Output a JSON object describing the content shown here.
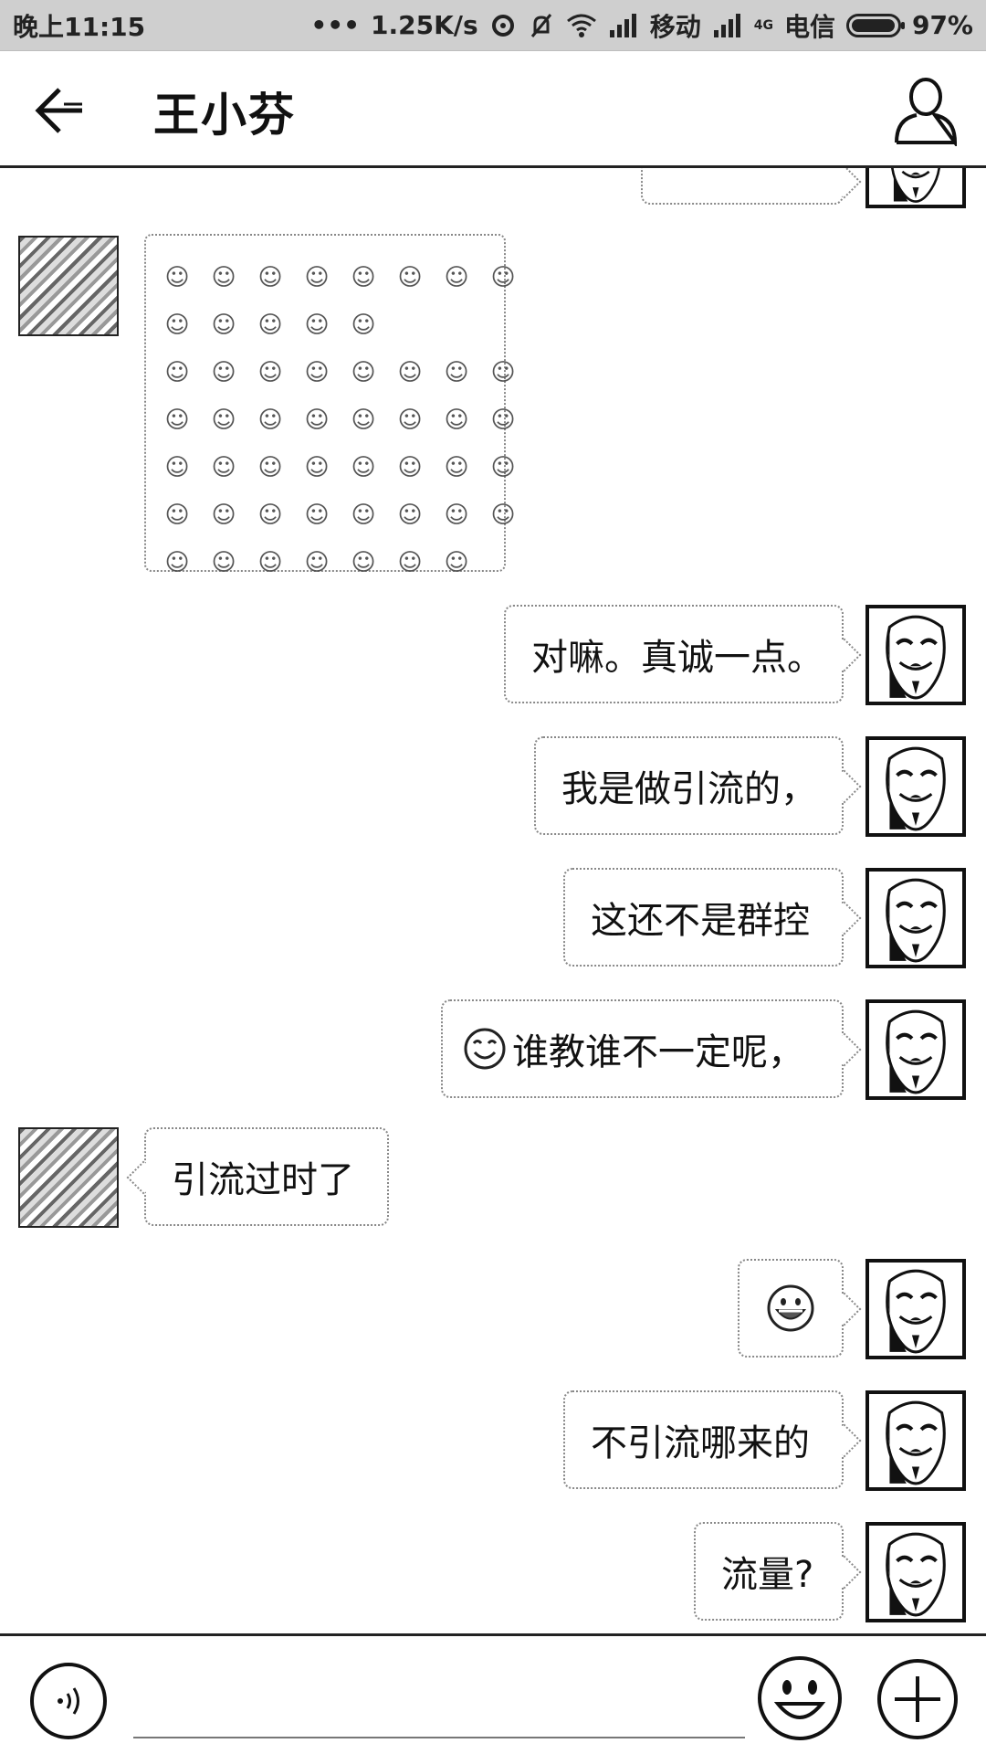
{
  "status_bar": {
    "time": "晚上11:15",
    "dots": "•••",
    "speed": "1.25K/s",
    "carrier1": "移动",
    "net_badge": "4G",
    "carrier2": "电信",
    "battery_text": "97%",
    "battery_level": 0.97
  },
  "header": {
    "title": "王小芬",
    "back_icon": "back-arrow-icon",
    "profile_icon": "person-icon"
  },
  "messages": [
    {
      "side": "left",
      "type": "emoji_grid",
      "rows": [
        8,
        5,
        8,
        8,
        8,
        8,
        7
      ]
    },
    {
      "side": "right",
      "text": "对嘛。真诚一点。"
    },
    {
      "side": "right",
      "text": "我是做引流的，"
    },
    {
      "side": "right",
      "text": "这还不是群控"
    },
    {
      "side": "right",
      "prefix_icon": "smiley-icon",
      "text": "谁教谁不一定呢，"
    },
    {
      "side": "left",
      "text": "引流过时了"
    },
    {
      "side": "right",
      "type": "emoji",
      "icon": "grinning-face-icon"
    },
    {
      "side": "right",
      "text": "不引流哪来的"
    },
    {
      "side": "right",
      "text": "流量?"
    }
  ],
  "input_bar": {
    "voice_icon": "voice-icon",
    "emoji_icon": "emoji-icon",
    "plus_icon": "plus-icon"
  },
  "colors": {
    "border": "#222222",
    "bubble_border": "#888888",
    "statusbar_bg": "#cfcfcf"
  }
}
